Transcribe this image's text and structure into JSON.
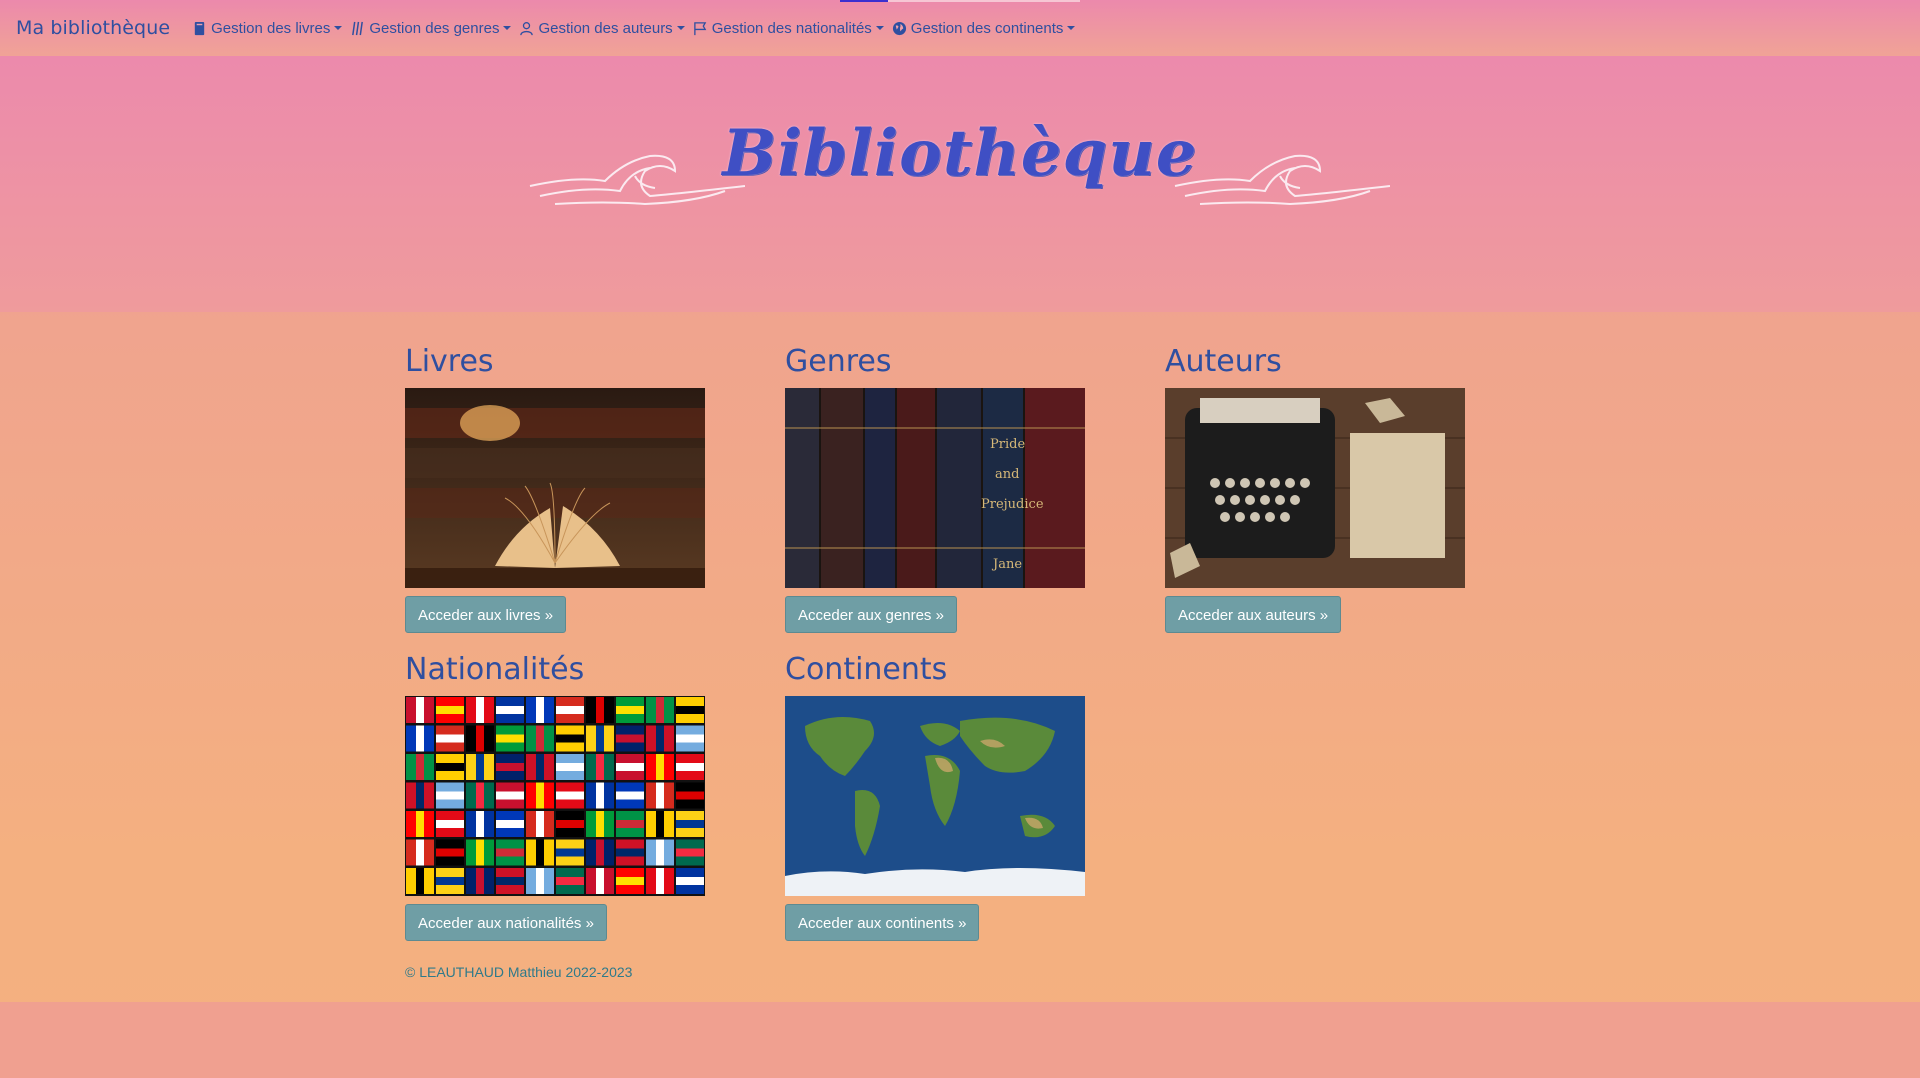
{
  "nav": {
    "brand": "Ma bibliothèque",
    "items": [
      {
        "label": "Gestion des livres",
        "icon": "book-icon"
      },
      {
        "label": "Gestion des genres",
        "icon": "genres-icon"
      },
      {
        "label": "Gestion des auteurs",
        "icon": "person-icon"
      },
      {
        "label": "Gestion des nationalités",
        "icon": "flag-icon"
      },
      {
        "label": "Gestion des continents",
        "icon": "globe-icon"
      }
    ]
  },
  "hero": {
    "title": "Bibliothèque"
  },
  "cards": [
    {
      "title": "Livres",
      "button": "Acceder aux livres »",
      "image": "open-book-image"
    },
    {
      "title": "Genres",
      "button": "Acceder aux genres »",
      "image": "book-spines-image"
    },
    {
      "title": "Auteurs",
      "button": "Acceder aux auteurs »",
      "image": "typewriter-image"
    },
    {
      "title": "Nationalités",
      "button": "Acceder aux nationalités »",
      "image": "flags-image"
    },
    {
      "title": "Continents",
      "button": "Acceder aux continents »",
      "image": "world-map-image"
    }
  ],
  "footer": {
    "text": "© LEAUTHAUD Matthieu 2022-2023"
  },
  "colors": {
    "text_blue": "#2f4fa0",
    "button": "#6f9ea5",
    "title": "#3f4fc4"
  }
}
